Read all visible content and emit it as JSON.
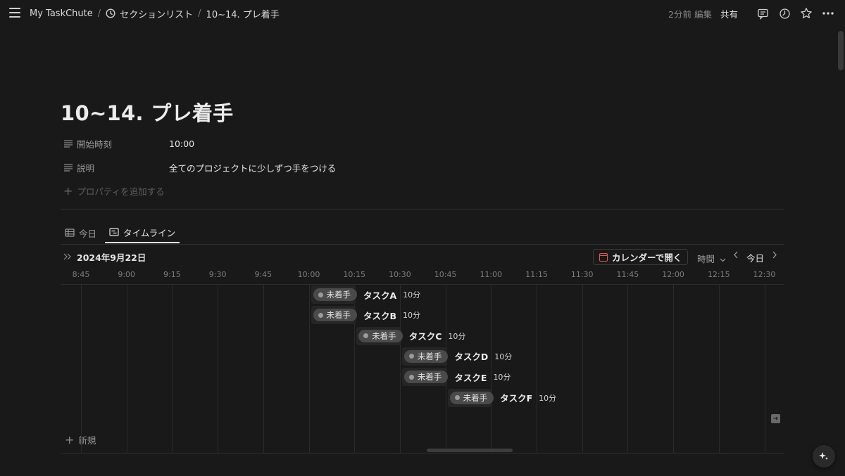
{
  "breadcrumb": {
    "workspace": "My TaskChute",
    "parent": "セクションリスト",
    "current": "10~14. プレ着手"
  },
  "topbar": {
    "edited": "2分前 編集",
    "share": "共有"
  },
  "page": {
    "title": "10~14. プレ着手",
    "properties": [
      {
        "name": "開始時刻",
        "value": "10:00"
      },
      {
        "name": "説明",
        "value": "全てのプロジェクトに少しずつ手をつける"
      }
    ],
    "add_property": "プロパティを追加する"
  },
  "views": {
    "tabs": [
      {
        "label": "今日",
        "active": false
      },
      {
        "label": "タイムライン",
        "active": true
      }
    ]
  },
  "timeline": {
    "date": "2024年9月22日",
    "open_calendar": "カレンダーで開く",
    "scale": "時間",
    "today": "今日",
    "ticks": [
      "8:45",
      "9:00",
      "9:15",
      "9:30",
      "9:45",
      "10:00",
      "10:15",
      "10:30",
      "10:45",
      "11:00",
      "11:15",
      "11:30",
      "11:45",
      "12:00",
      "12:15",
      "12:30"
    ],
    "tasks": [
      {
        "status": "未着手",
        "name": "タスクA",
        "duration": "10分",
        "start": "10:00",
        "end": "10:15"
      },
      {
        "status": "未着手",
        "name": "タスクB",
        "duration": "10分",
        "start": "10:00",
        "end": "10:15"
      },
      {
        "status": "未着手",
        "name": "タスクC",
        "duration": "10分",
        "start": "10:15",
        "end": "10:30"
      },
      {
        "status": "未着手",
        "name": "タスクD",
        "duration": "10分",
        "start": "10:30",
        "end": "10:45"
      },
      {
        "status": "未着手",
        "name": "タスクE",
        "duration": "10分",
        "start": "10:30",
        "end": "10:45"
      },
      {
        "status": "未着手",
        "name": "タスクF",
        "duration": "10分",
        "start": "10:45",
        "end": "11:00"
      }
    ],
    "new_label": "新規"
  },
  "colors": {
    "background": "#191919",
    "status_badge": "#4a4a4a",
    "calendar_icon": "#e25757"
  }
}
